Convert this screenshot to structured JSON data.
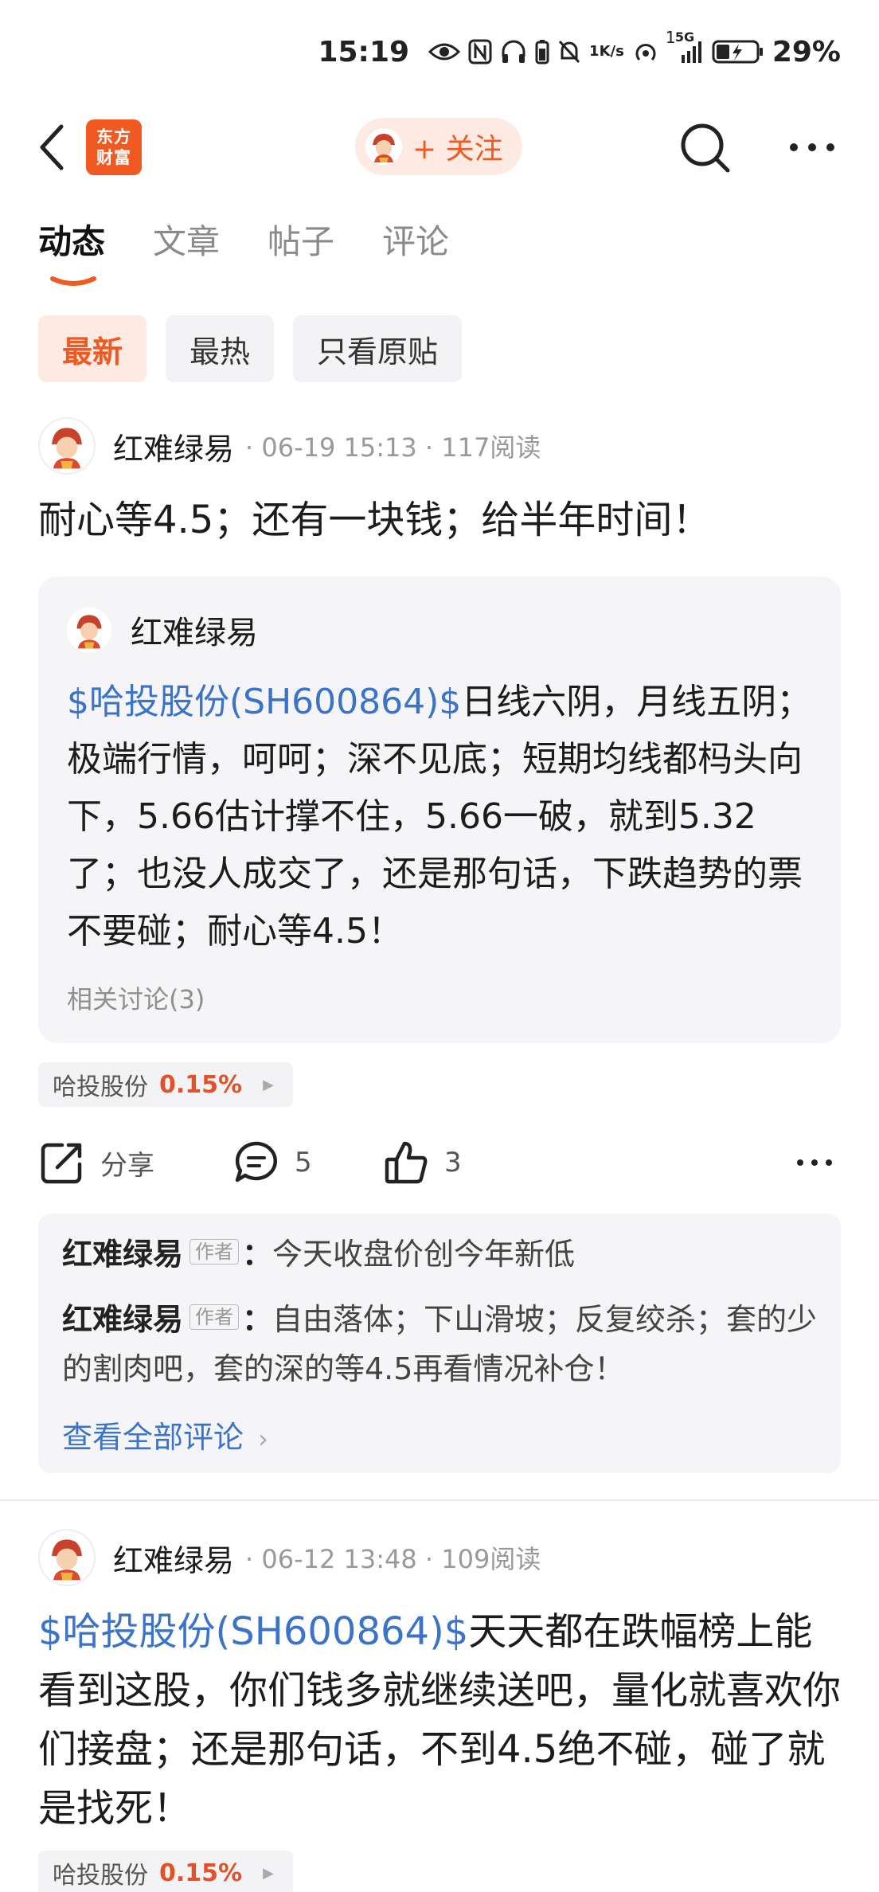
{
  "status_bar": {
    "time": "15:19",
    "net_speed_value": "1",
    "net_speed_unit": "K/s",
    "signal_sup": "1",
    "network_type": "5G",
    "battery_pct": "29%"
  },
  "nav": {
    "logo_line1": "东方",
    "logo_line2": "财富",
    "follow_label": "+ 关注"
  },
  "tabs": [
    {
      "label": "动态"
    },
    {
      "label": "文章"
    },
    {
      "label": "帖子"
    },
    {
      "label": "评论"
    }
  ],
  "filters": [
    {
      "label": "最新"
    },
    {
      "label": "最热"
    },
    {
      "label": "只看原贴"
    }
  ],
  "post1": {
    "author": "红难绿易",
    "meta": "· 06-19 15:13 · 117阅读",
    "text": "耐心等4.5；还有一块钱；给半年时间！",
    "quote": {
      "author": "红难绿易",
      "link": "$哈投股份(SH600864)$",
      "body": "日线六阴，月线五阴；极端行情，呵呵；深不见底；短期均线都�West头向下，5.66估计撑不住，5.66一破，就到5.32了；也没人成交了，还是那句话，下跌趋势的票不要碰；耐心等4.5！",
      "related": "相关讨论(3)"
    },
    "stock_tag": {
      "name": "哈投股份",
      "pct": "0.15%"
    },
    "actions": {
      "share_label": "分享",
      "comment_count": "5",
      "like_count": "3"
    },
    "comments": [
      {
        "author": "红难绿易",
        "badge": "作者",
        "sep": "：",
        "text": "今天收盘价创今年新低"
      },
      {
        "author": "红难绿易",
        "badge": "作者",
        "sep": "：",
        "text": "自由落体；下山滑坡；反复绞杀；套的少的割肉吧，套的深的等4.5再看情况补仓！"
      }
    ],
    "view_all": "查看全部评论"
  },
  "post2": {
    "author": "红难绿易",
    "meta": "· 06-12 13:48 · 109阅读",
    "link": "$哈投股份(SH600864)$",
    "text": "天天都在跌幅榜上能看到这股，你们钱多就继续送吧，量化就喜欢你们接盘；还是那句话，不到4.5绝不碰，碰了就是找死！",
    "stock_tag": {
      "name": "哈投股份",
      "pct": "0.15%"
    }
  },
  "colors": {
    "accent": "#f05a22",
    "link": "#3a73c8",
    "card_bg": "#f5f5f7",
    "up_red": "#e0522a"
  }
}
